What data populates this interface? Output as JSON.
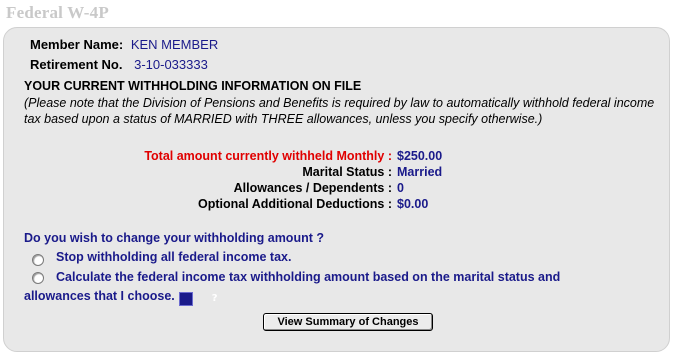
{
  "page": {
    "title": "Federal W-4P"
  },
  "member": {
    "name_label": "Member Name:",
    "name_value": "KEN MEMBER",
    "retirement_label": "Retirement No.",
    "retirement_value": "3-10-033333"
  },
  "withholding": {
    "heading": "YOUR CURRENT WITHHOLDING INFORMATION ON FILE",
    "notice": "(Please note that the Division of Pensions and Benefits is required by law to automatically withhold federal income tax based upon a status of MARRIED with THREE allowances, unless you specify otherwise.)",
    "total_label": "Total amount currently withheld Monthly :",
    "total_value": "$250.00",
    "marital_label": "Marital Status :",
    "marital_value": "Married",
    "allowances_label": "Allowances / Dependents :",
    "allowances_value": "0",
    "additional_label": "Optional Additional Deductions :",
    "additional_value": "$0.00"
  },
  "change": {
    "question": "Do you wish to change your withholding amount ?",
    "option_stop": "Stop withholding all federal income tax.",
    "option_calculate": "Calculate the federal income tax withholding amount based on the marital status and allowances that I choose.",
    "help_icon": "help-icon",
    "help_glyph": "?",
    "button_label": "View Summary of Changes"
  },
  "colors": {
    "label_blue": "#1a1a8a",
    "alert_red": "#e00000",
    "panel_bg": "#e8e8e8",
    "title_gray": "#c9c9c9"
  }
}
